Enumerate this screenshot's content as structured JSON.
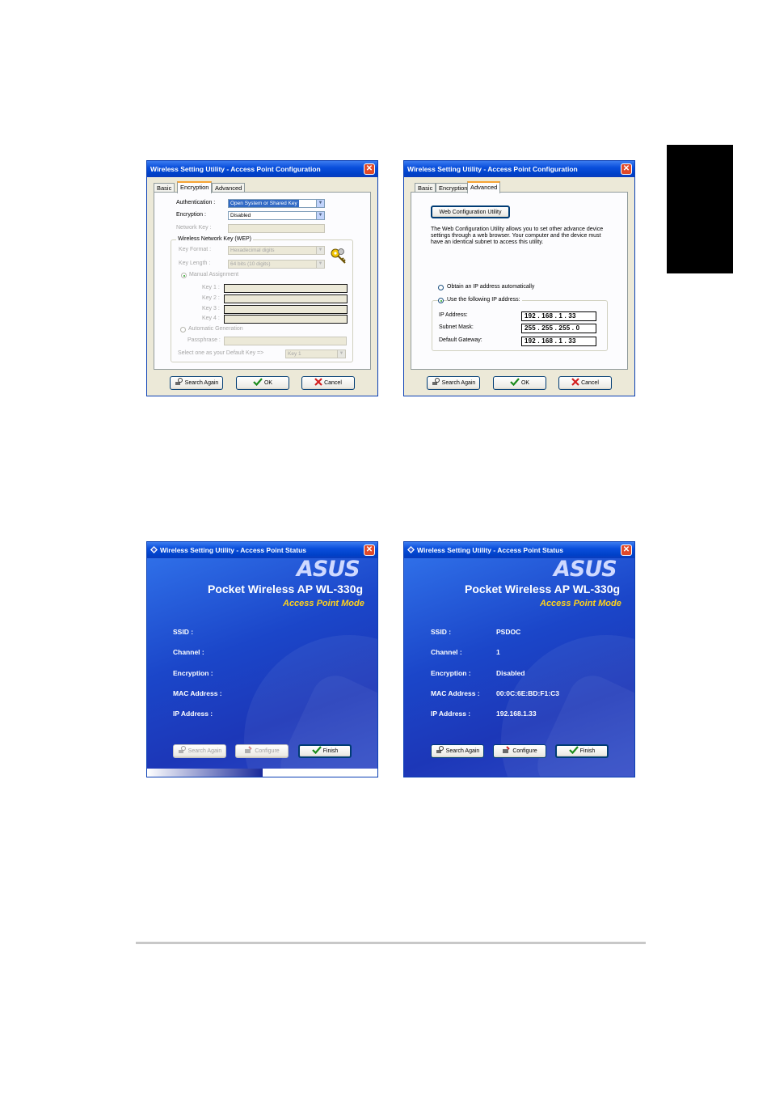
{
  "dialog_config_encryption": {
    "title": "Wireless Setting Utility - Access Point Configuration",
    "tabs": [
      "Basic",
      "Encryption",
      "Advanced"
    ],
    "active_tab": "Encryption",
    "authentication_label": "Authentication :",
    "authentication_value": "Open System or Shared Key",
    "encryption_label": "Encryption :",
    "encryption_value": "Disabled",
    "network_key_label": "Network Key :",
    "wep_group_title": "Wireless Network Key (WEP)",
    "key_format_label": "Key Format :",
    "key_format_value": "Hexadecimal digits",
    "key_length_label": "Key Length :",
    "key_length_value": "64 bits (10 digits)",
    "manual_assignment_label": "Manual Assignment",
    "key1_label": "Key 1 :",
    "key2_label": "Key 2 :",
    "key3_label": "Key 3 :",
    "key4_label": "Key 4 :",
    "automatic_generation_label": "Automatic Generation",
    "passphrase_label": "Passphrase :",
    "default_key_label": "Select one as your Default Key =>",
    "default_key_value": "Key 1",
    "search_again_label": "Search Again",
    "ok_label": "OK",
    "cancel_label": "Cancel"
  },
  "dialog_config_advanced": {
    "title": "Wireless Setting Utility - Access Point Configuration",
    "tabs": [
      "Basic",
      "Encryption",
      "Advanced"
    ],
    "active_tab": "Advanced",
    "web_config_button": "Web Configuration Utility",
    "description_line1": "The Web Configuration Utility allows you to set other advance device",
    "description_line2": "settings through a web browser. Your computer and the device must",
    "description_line3": "have an identical subnet to access this utility.",
    "obtain_auto_label": "Obtain an IP address automatically",
    "use_following_label": "Use the following IP address:",
    "ip_address_label": "IP Address:",
    "ip_address_value": "192 . 168 .   1   .  33",
    "subnet_mask_label": "Subnet Mask:",
    "subnet_mask_value": "255 . 255 . 255 .   0",
    "default_gateway_label": "Default Gateway:",
    "default_gateway_value": "192 . 168 .   1   .  33",
    "search_again_label": "Search Again",
    "ok_label": "OK",
    "cancel_label": "Cancel"
  },
  "dialog_status_scanning": {
    "title": "Wireless Setting Utility - Access Point Status",
    "logo": "ASUS",
    "product": "Pocket Wireless AP WL-330g",
    "mode": "Access Point Mode",
    "ssid_label": "SSID :",
    "channel_label": "Channel :",
    "encryption_label": "Encryption :",
    "mac_label": "MAC Address :",
    "ip_label": "IP Address :",
    "search_again_label": "Search Again",
    "configure_label": "Configure",
    "finish_label": "Finish",
    "progress_fraction": 0.5
  },
  "dialog_status_found": {
    "title": "Wireless Setting Utility - Access Point Status",
    "logo": "ASUS",
    "product": "Pocket Wireless AP WL-330g",
    "mode": "Access Point Mode",
    "ssid_label": "SSID :",
    "ssid_value": "PSDOC",
    "channel_label": "Channel :",
    "channel_value": "1",
    "encryption_label": "Encryption :",
    "encryption_value": "Disabled",
    "mac_label": "MAC Address :",
    "mac_value": "00:0C:6E:BD:F1:C3",
    "ip_label": "IP Address :",
    "ip_value": "192.168.1.33",
    "search_again_label": "Search Again",
    "configure_label": "Configure",
    "finish_label": "Finish"
  },
  "colors": {
    "titlebar": "#0a4fdc",
    "dialog_bg": "#ece9d8",
    "status_bg": "#1b46c9",
    "mode_text": "#ffd21a",
    "side_tab": "#000000"
  }
}
